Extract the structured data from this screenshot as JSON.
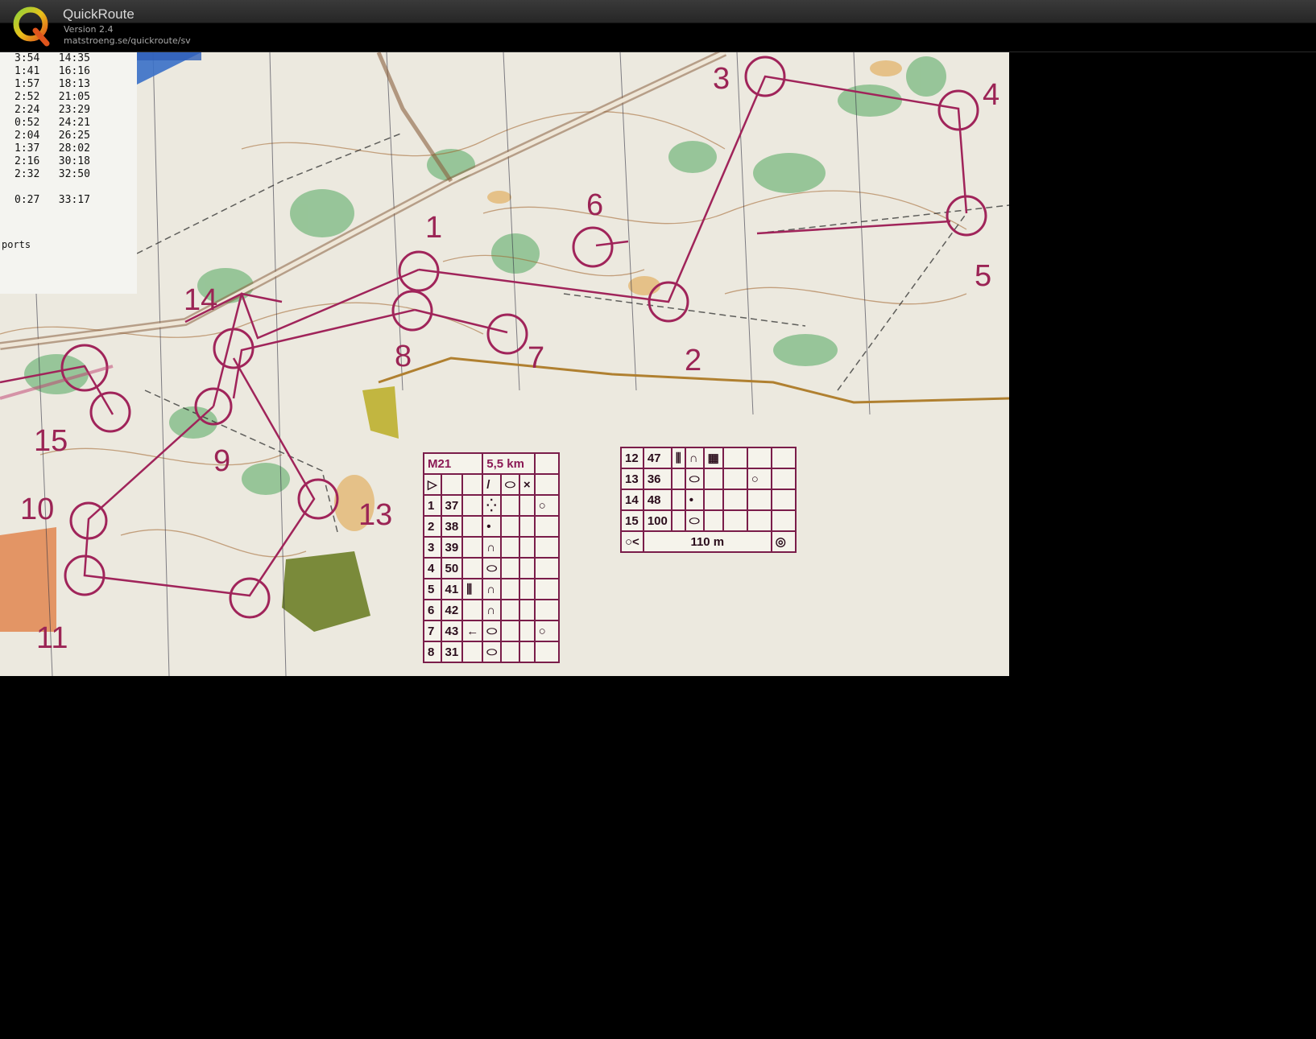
{
  "app": {
    "title": "QuickRoute",
    "version": "Version 2.4",
    "url": "matstroeng.se/quickroute/sv"
  },
  "splits": [
    {
      "leg": "3:54",
      "total": "14:35"
    },
    {
      "leg": "1:41",
      "total": "16:16"
    },
    {
      "leg": "1:57",
      "total": "18:13"
    },
    {
      "leg": "2:52",
      "total": "21:05"
    },
    {
      "leg": "2:24",
      "total": "23:29"
    },
    {
      "leg": "0:52",
      "total": "24:21"
    },
    {
      "leg": "2:04",
      "total": "26:25"
    },
    {
      "leg": "1:37",
      "total": "28:02"
    },
    {
      "leg": "2:16",
      "total": "30:18"
    },
    {
      "leg": "2:32",
      "total": "32:50"
    },
    {
      "leg": "0:27",
      "total": "33:17"
    }
  ],
  "splits_footer": "ports",
  "controls": [
    {
      "label": "1"
    },
    {
      "label": "2"
    },
    {
      "label": "3"
    },
    {
      "label": "4"
    },
    {
      "label": "5"
    },
    {
      "label": "6"
    },
    {
      "label": "7"
    },
    {
      "label": "8"
    },
    {
      "label": "9"
    },
    {
      "label": "10"
    },
    {
      "label": "11"
    },
    {
      "label": "13"
    },
    {
      "label": "14"
    },
    {
      "label": "15"
    }
  ],
  "description_sheet": {
    "class": "M21",
    "length": "5,5 km",
    "rows_left": [
      {
        "num": "1",
        "code": "37"
      },
      {
        "num": "2",
        "code": "38"
      },
      {
        "num": "3",
        "code": "39"
      },
      {
        "num": "4",
        "code": "50"
      },
      {
        "num": "5",
        "code": "41"
      },
      {
        "num": "6",
        "code": "42"
      },
      {
        "num": "7",
        "code": "43"
      },
      {
        "num": "8",
        "code": "31"
      }
    ],
    "rows_right": [
      {
        "num": "12",
        "code": "47"
      },
      {
        "num": "13",
        "code": "36"
      },
      {
        "num": "14",
        "code": "48"
      },
      {
        "num": "15",
        "code": "100"
      }
    ],
    "finish_distance": "110 m"
  }
}
